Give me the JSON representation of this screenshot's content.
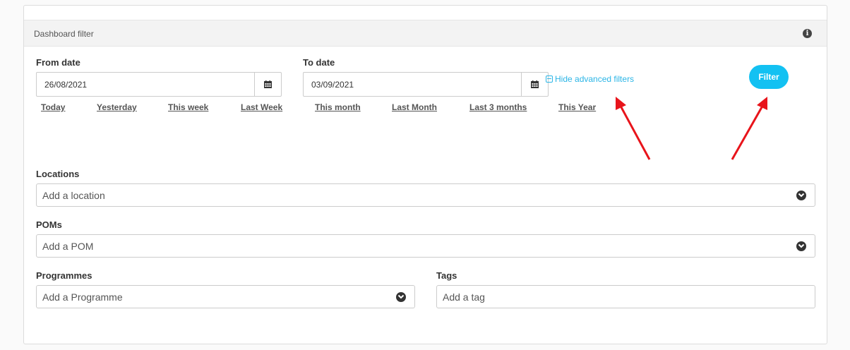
{
  "panel": {
    "title": "Dashboard filter",
    "info_icon": "info-icon"
  },
  "from_date": {
    "label": "From date",
    "value": "26/08/2021",
    "icon": "calendar-icon"
  },
  "to_date": {
    "label": "To date",
    "value": "03/09/2021",
    "icon": "calendar-icon"
  },
  "quick_ranges": [
    "Today",
    "Yesterday",
    "This week",
    "Last Week",
    "This month",
    "Last Month",
    "Last 3 months",
    "This Year"
  ],
  "advanced": {
    "toggle_label": "Hide advanced filters",
    "icon": "minus-square-icon"
  },
  "filter_button": {
    "label": "Filter"
  },
  "locations": {
    "label": "Locations",
    "placeholder": "Add a location"
  },
  "poms": {
    "label": "POMs",
    "placeholder": "Add a POM"
  },
  "programmes": {
    "label": "Programmes",
    "placeholder": "Add a Programme"
  },
  "tags": {
    "label": "Tags",
    "placeholder": "Add a tag"
  },
  "annotation": {
    "arrow_color": "#e8141b",
    "accent_color": "#13c1f2"
  }
}
